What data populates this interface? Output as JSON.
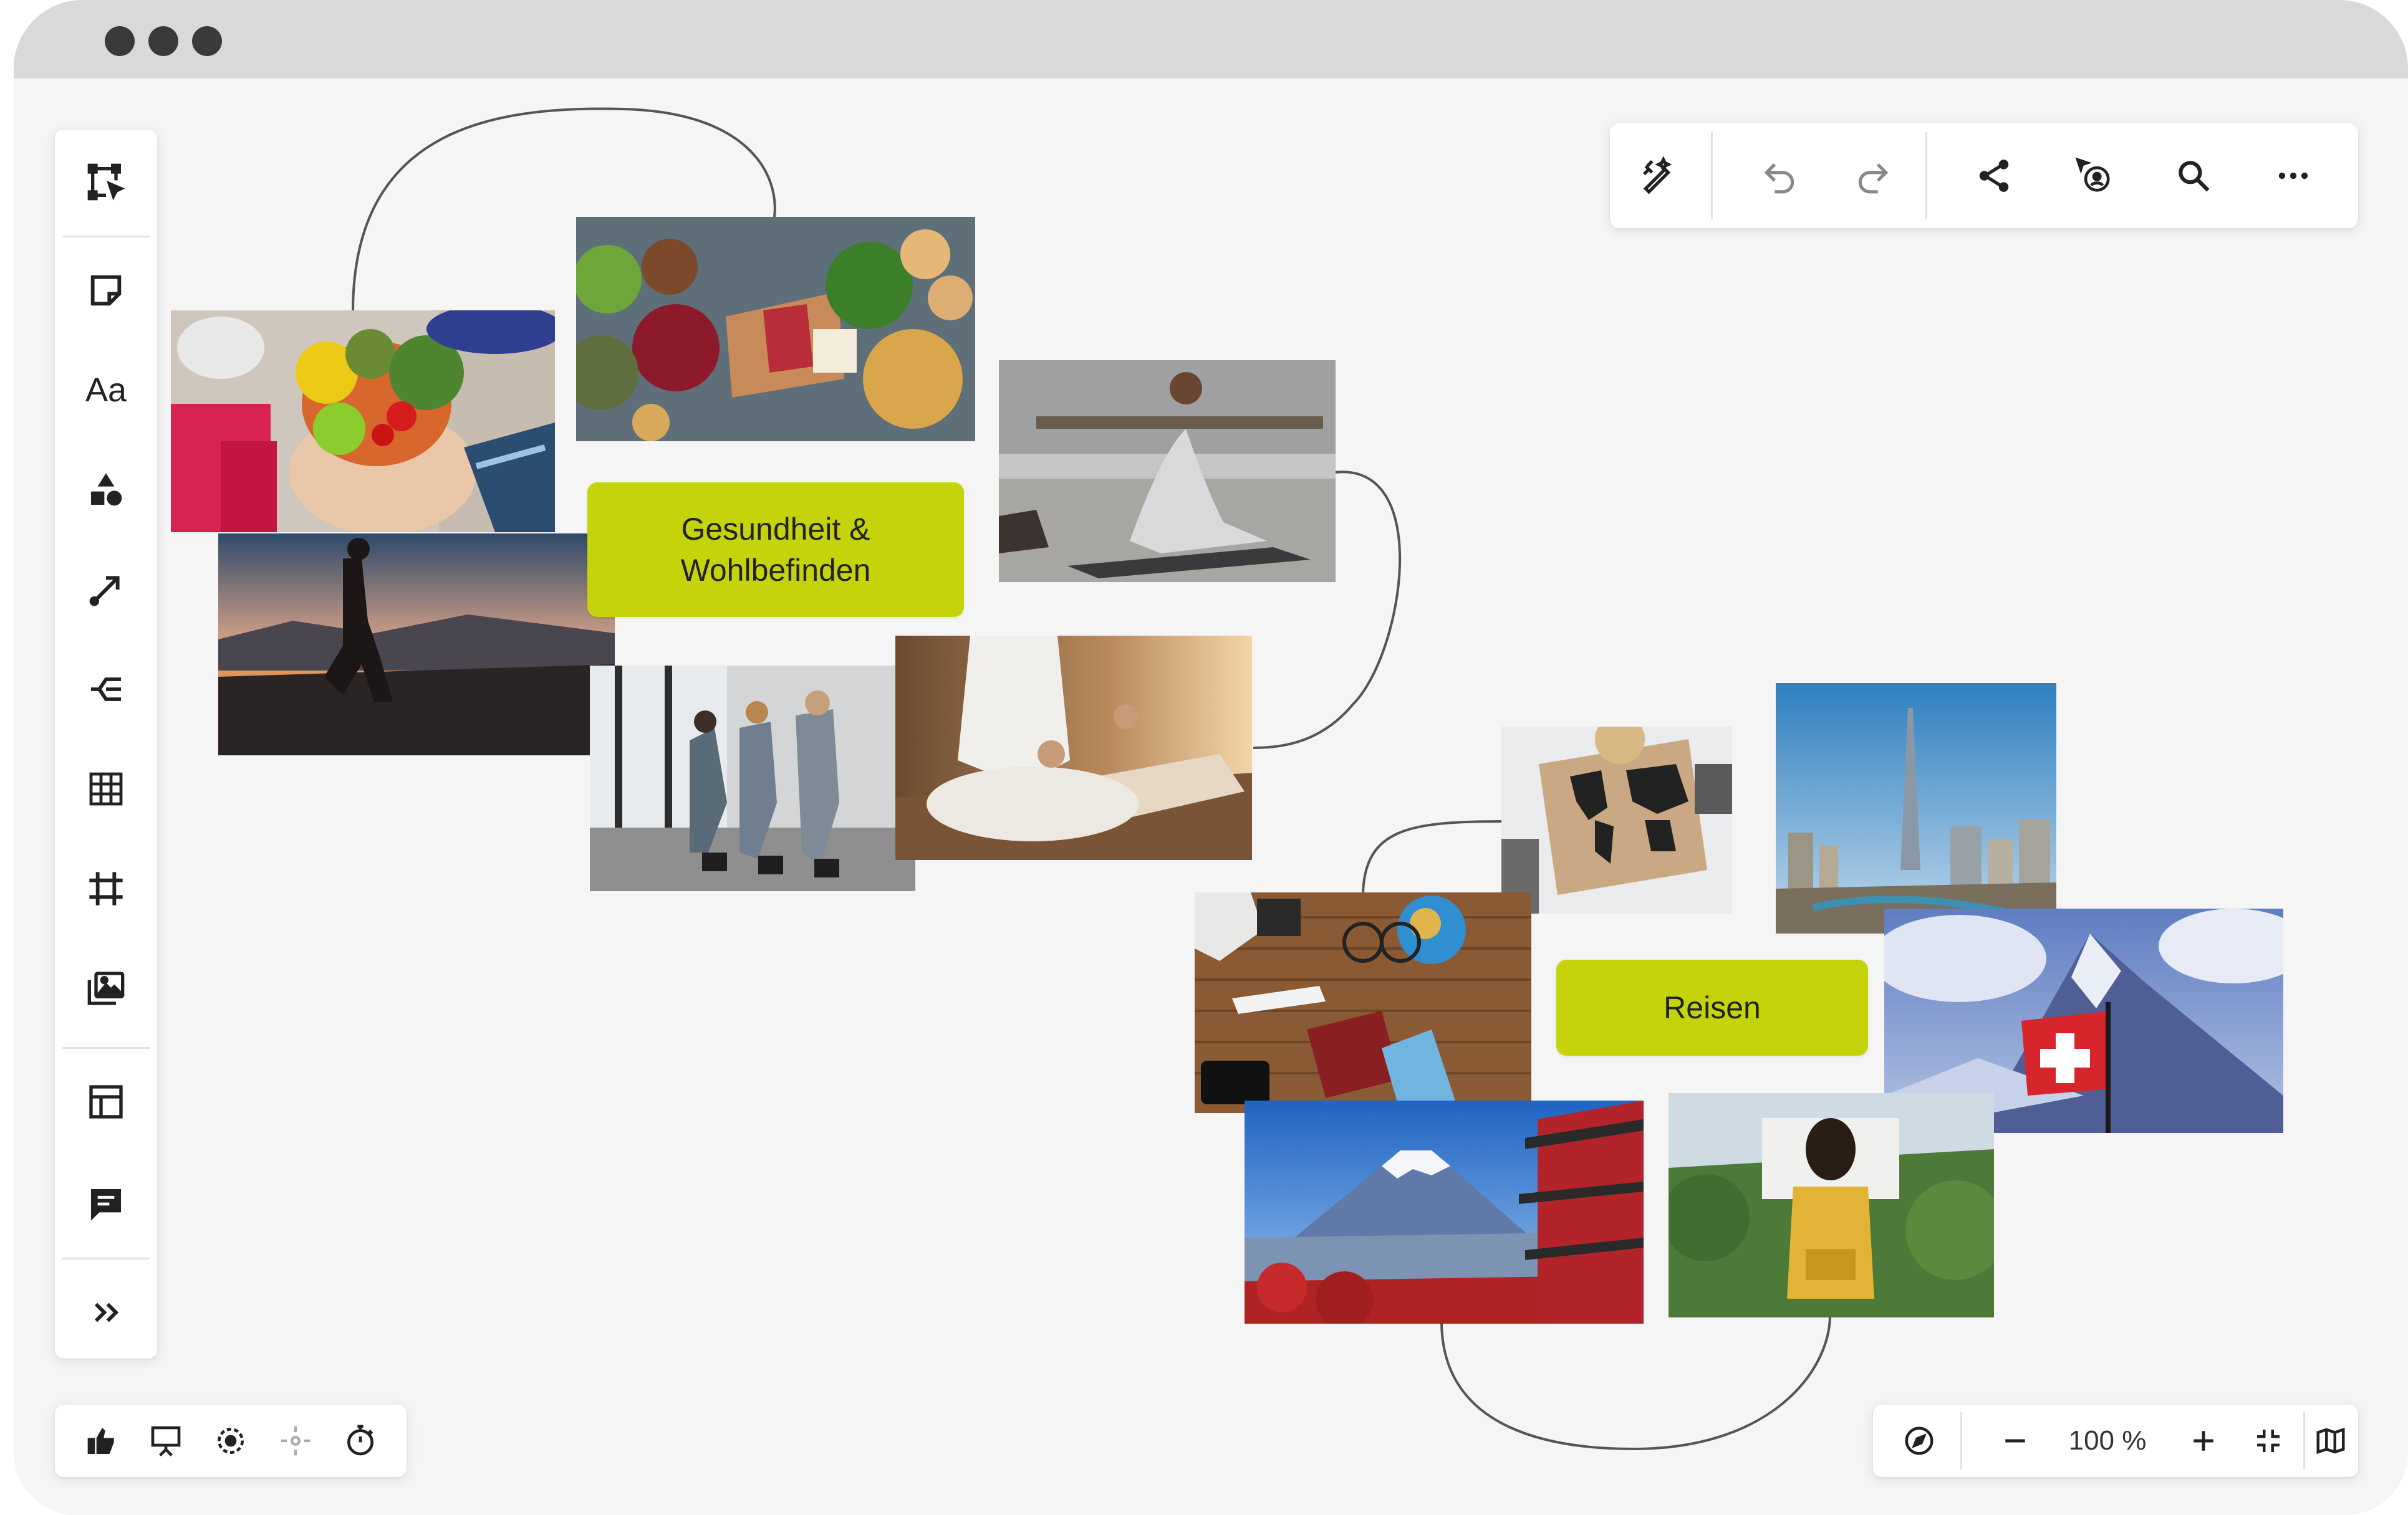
{
  "window": {
    "titlebar_dots": [
      "close",
      "minimize",
      "maximize"
    ]
  },
  "left_toolbar": {
    "items": [
      {
        "name": "select-frame-tool",
        "icon": "select-frame-icon"
      },
      {
        "name": "sticky-note-tool",
        "icon": "sticky-note-icon"
      },
      {
        "name": "text-tool",
        "icon": "text-icon",
        "label": "Aa"
      },
      {
        "name": "shapes-tool",
        "icon": "shapes-icon"
      },
      {
        "name": "connector-tool",
        "icon": "arrow-line-icon"
      },
      {
        "name": "mindmap-tool",
        "icon": "mindmap-icon"
      },
      {
        "name": "table-tool",
        "icon": "table-icon"
      },
      {
        "name": "frame-tool",
        "icon": "frame-icon"
      },
      {
        "name": "media-tool",
        "icon": "images-icon"
      },
      {
        "name": "templates-tool",
        "icon": "layout-icon"
      },
      {
        "name": "comment-tool",
        "icon": "comment-icon"
      },
      {
        "name": "more-tools",
        "icon": "double-chevron-right-icon"
      }
    ]
  },
  "top_toolbar": {
    "items": [
      "magic-edit-icon",
      "undo-icon",
      "redo-icon",
      "share-icon",
      "follow-user-icon",
      "search-icon",
      "more-icon"
    ]
  },
  "bottom_left_toolbar": {
    "items": [
      "thumbs-up-icon",
      "presentation-icon",
      "focus-icon",
      "move-icon",
      "timer-icon"
    ]
  },
  "bottom_right_toolbar": {
    "zoom_level": "100 %",
    "items": [
      "compass-icon",
      "zoom-out-icon",
      "zoom-in-icon",
      "fit-screen-icon",
      "map-icon"
    ]
  },
  "board": {
    "cards": [
      {
        "id": "health",
        "text": "Gesundheit & Wohlbefinden",
        "color": "#c5d40a"
      },
      {
        "id": "travel",
        "text": "Reisen",
        "color": "#c5d40a"
      }
    ],
    "photos": [
      {
        "name": "photo-healthy-food-hands",
        "subject": "fruit-bowl"
      },
      {
        "name": "photo-food-ingredients",
        "subject": "ingredients"
      },
      {
        "name": "photo-yoga-stretch",
        "subject": "yoga"
      },
      {
        "name": "photo-running-sunset",
        "subject": "runner"
      },
      {
        "name": "photo-gym-class",
        "subject": "gym"
      },
      {
        "name": "photo-meditation",
        "subject": "meditation"
      },
      {
        "name": "photo-world-map",
        "subject": "map"
      },
      {
        "name": "photo-dubai-skyline",
        "subject": "skyline"
      },
      {
        "name": "photo-travel-flatlay",
        "subject": "flatlay"
      },
      {
        "name": "photo-swiss-matterhorn",
        "subject": "mountain-flag"
      },
      {
        "name": "photo-japan-fuji",
        "subject": "fuji"
      },
      {
        "name": "photo-backpacker",
        "subject": "backpacker"
      }
    ]
  },
  "colors": {
    "accent_card": "#c5d40a",
    "canvas": "#f5f5f5",
    "titlebar": "#d9d9d9"
  }
}
